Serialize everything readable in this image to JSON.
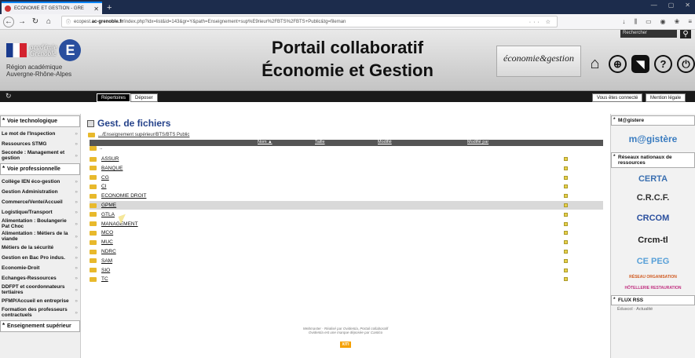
{
  "browser": {
    "tab_title": "ECONOMIE ET GESTION - GRE",
    "url": "ecopest.ac-grenoble.fr/index.php?idx=list&id=143&gr=Y&path=Enseignement+sup%E9rieur%2FBTS%2FBTS+Public&tg=fileman",
    "url_domain": "ac-grenoble.fr",
    "url_prefix": "ecopest.",
    "url_suffix": "/index.php?idx=list&id=143&gr=Y&path=Enseignement+sup%E9rieur%2FBTS%2FBTS+Public&tg=fileman",
    "new_tab": "+"
  },
  "header": {
    "academie_line1": "académie",
    "academie_line2": "Grenoble",
    "logo_letter": "E",
    "region_line1": "Région académique",
    "region_line2": "Auvergne-Rhône-Alpes",
    "title_line1": "Portail collaboratif",
    "title_line2": "Économie et Gestion",
    "eco_logo": "économie&gestion",
    "search_placeholder": "Rechercher"
  },
  "menubar": {
    "tab_repertoires": "Répertoires",
    "tab_deposer": "Déposer",
    "connected": "Vous êtes connecté",
    "mentions": "Mention légale"
  },
  "leftnav": {
    "sections": [
      {
        "title": "Voie technologique",
        "items": [
          "Le mot de l'Inspection",
          "Ressources STMG",
          "Seconde : Management et gestion"
        ]
      },
      {
        "title": "Voie professionnelle",
        "items": [
          "Collège IEN éco-gestion",
          "Gestion Administration",
          "Commerce/Vente/Accueil",
          "Logistique/Transport",
          "Alimentation : Boulangerie Pat Choc",
          "Alimentation : Métiers de la viande",
          "Métiers de la sécurité",
          "Gestion en Bac Pro indus.",
          "Economie-Droit",
          "Echanges-Ressources",
          "DDFPT et coordonnateurs tertiaires",
          "PFMP/Accueil en entreprise",
          "Formation des professeurs contractuels"
        ]
      },
      {
        "title": "Enseignement supérieur",
        "items": []
      }
    ]
  },
  "content": {
    "title": "Gest. de fichiers",
    "path": ".../Enseignement supérieur/BTS/BTS Public",
    "columns": {
      "name": "Nom ▲",
      "size": "Taille",
      "modified": "Modifié",
      "modified_by": "Modifié par"
    },
    "parent": "..",
    "folders": [
      "ASSUR",
      "BANQUE",
      "CG",
      "CI",
      "ECONOMIE DROIT",
      "GPME",
      "GTLA",
      "MANAGEMENT",
      "MCO",
      "MUC",
      "NDRC",
      "SAM",
      "SIO",
      "TC"
    ],
    "highlighted": "GPME",
    "footer_line1": "Webmaster - Réalisé par Ovidentia, Portail collaboratif",
    "footer_line2": "Ovidentia est une marque déposée par Cantico",
    "xiti": "XITI"
  },
  "rightnav": {
    "magistere_head": "M@gistere",
    "magistere_logo": "m@gistère",
    "reseaux_head": "Réseaux nationaux de ressources",
    "logos": [
      "CERTA",
      "C.R.C.F.",
      "CRCOM",
      "Crcm-tl",
      "CE PEG",
      "RÉSEAU ORGANISATION",
      "HÔTELLERIE RESTAURATION"
    ],
    "rss_head": "FLUX RSS",
    "rss_items": "Éduscol · Actualité"
  },
  "colors": {
    "accent": "#25428a",
    "menubar": "#1a1a1a",
    "header_gradient_top": "#e9e9e9"
  }
}
